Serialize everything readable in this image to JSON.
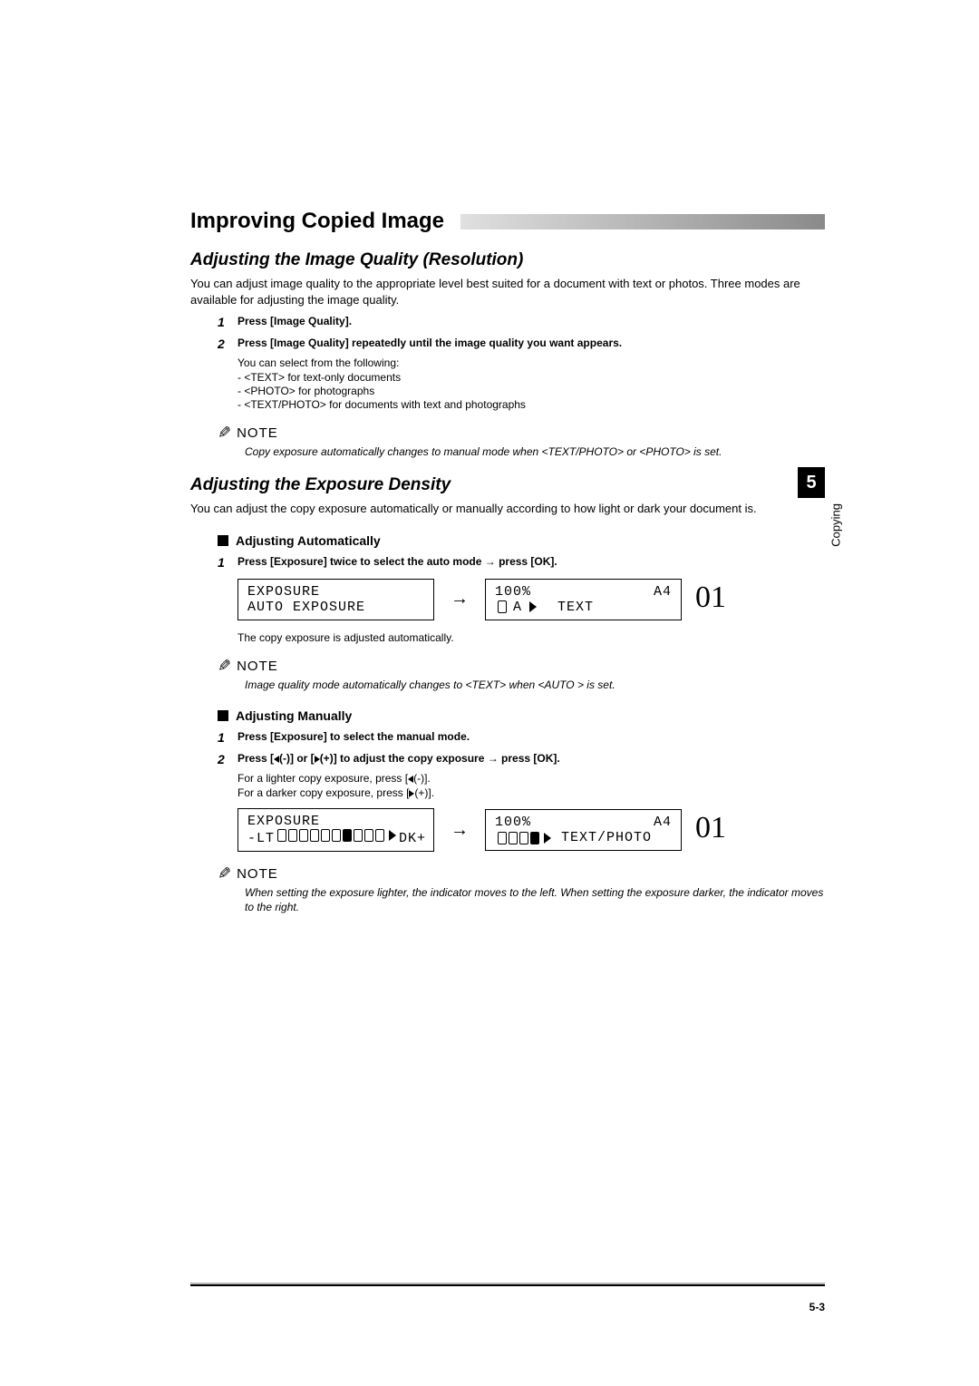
{
  "header": {
    "title": "Improving Copied Image"
  },
  "section1": {
    "heading": "Adjusting the Image Quality (Resolution)",
    "intro": "You can adjust image quality to the appropriate level best suited for a document with text or photos. Three modes are available for adjusting the image quality.",
    "steps": {
      "s1": {
        "num": "1",
        "text": "Press [Image Quality]."
      },
      "s2": {
        "num": "2",
        "text": "Press [Image Quality] repeatedly until the image quality you want appears.",
        "sub": "You can select from the following:",
        "opts": {
          "o1": "-  <TEXT> for text-only documents",
          "o2": "-  <PHOTO> for photographs",
          "o3": "-  <TEXT/PHOTO> for documents with text and photographs"
        }
      }
    },
    "note": {
      "label": "NOTE",
      "body": "Copy exposure automatically changes to manual mode when <TEXT/PHOTO> or <PHOTO> is set."
    }
  },
  "section2": {
    "heading": "Adjusting the Exposure Density",
    "intro": "You can adjust the copy exposure automatically or manually according to how light or dark your document is.",
    "auto": {
      "heading": "Adjusting Automatically",
      "step": {
        "num": "1",
        "text": "Press [Exposure] twice to select the auto mode → press [OK]."
      },
      "lcd_left": {
        "l1": "EXPOSURE",
        "l2": " AUTO EXPOSURE"
      },
      "lcd_right": {
        "tl": "100%",
        "tr": "A4",
        "bl_a": "A",
        "br": "TEXT"
      },
      "copies": "01",
      "after": "The copy exposure is adjusted automatically.",
      "note": {
        "label": "NOTE",
        "body": "Image quality mode automatically changes to <TEXT> when <AUTO > is set."
      }
    },
    "manual": {
      "heading": "Adjusting Manually",
      "steps": {
        "s1": {
          "num": "1",
          "text": "Press [Exposure] to select the manual mode."
        },
        "s2_num": "2",
        "s2_pre": "Press [",
        "s2_mid1": "(-)] or [",
        "s2_mid2": "(+)] to adjust the copy exposure → press [OK].",
        "tip1_pre": "For a lighter copy exposure, press [",
        "tip1_post": "(-)].",
        "tip2_pre": "For a darker copy exposure, press [",
        "tip2_post": "(+)]."
      },
      "lcd_left": {
        "l1": "EXPOSURE",
        "l2_pre": " -LT",
        "l2_post": "DK+"
      },
      "lcd_right": {
        "tl": "100%",
        "tr": "A4",
        "br": "TEXT/PHOTO"
      },
      "copies": "01",
      "note": {
        "label": "NOTE",
        "body": "When setting the exposure lighter, the indicator moves to the left. When setting the exposure darker, the indicator moves to the right."
      }
    }
  },
  "sidebar": {
    "chapter": "5",
    "label": "Copying"
  },
  "footer": {
    "page": "5-3"
  }
}
